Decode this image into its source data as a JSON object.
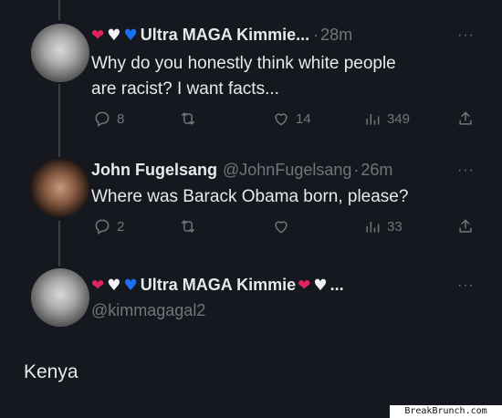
{
  "tweets": [
    {
      "emoji_hearts": [
        "red-heart",
        "white-heart",
        "blue-heart"
      ],
      "author": "Ultra MAGA Kimmie...",
      "time_sep": "·",
      "time": "28m",
      "text_line1": "Why do you honestly think white people",
      "text_line2": "are racist? I want facts...",
      "replies": "8",
      "retweets": "",
      "likes": "14",
      "views": "349"
    },
    {
      "author": "John Fugelsang",
      "handle": "@JohnFugelsang",
      "time_sep": "·",
      "time": "26m",
      "text": "Where was Barack Obama born, please?",
      "replies": "2",
      "retweets": "",
      "likes": "",
      "views": "33"
    },
    {
      "emoji_hearts": [
        "red-heart",
        "white-heart",
        "blue-heart"
      ],
      "author": "Ultra MAGA Kimmie",
      "trailing": "...",
      "handle": "@kimmagagal2",
      "text": "Kenya"
    }
  ],
  "more_glyph": "···",
  "watermark": "BreakBrunch.com",
  "colors": {
    "background": "#15181f",
    "text": "#e7e9ea",
    "muted": "#71767b",
    "heart_red": "#e0245e",
    "heart_blue": "#1d6ff2"
  }
}
